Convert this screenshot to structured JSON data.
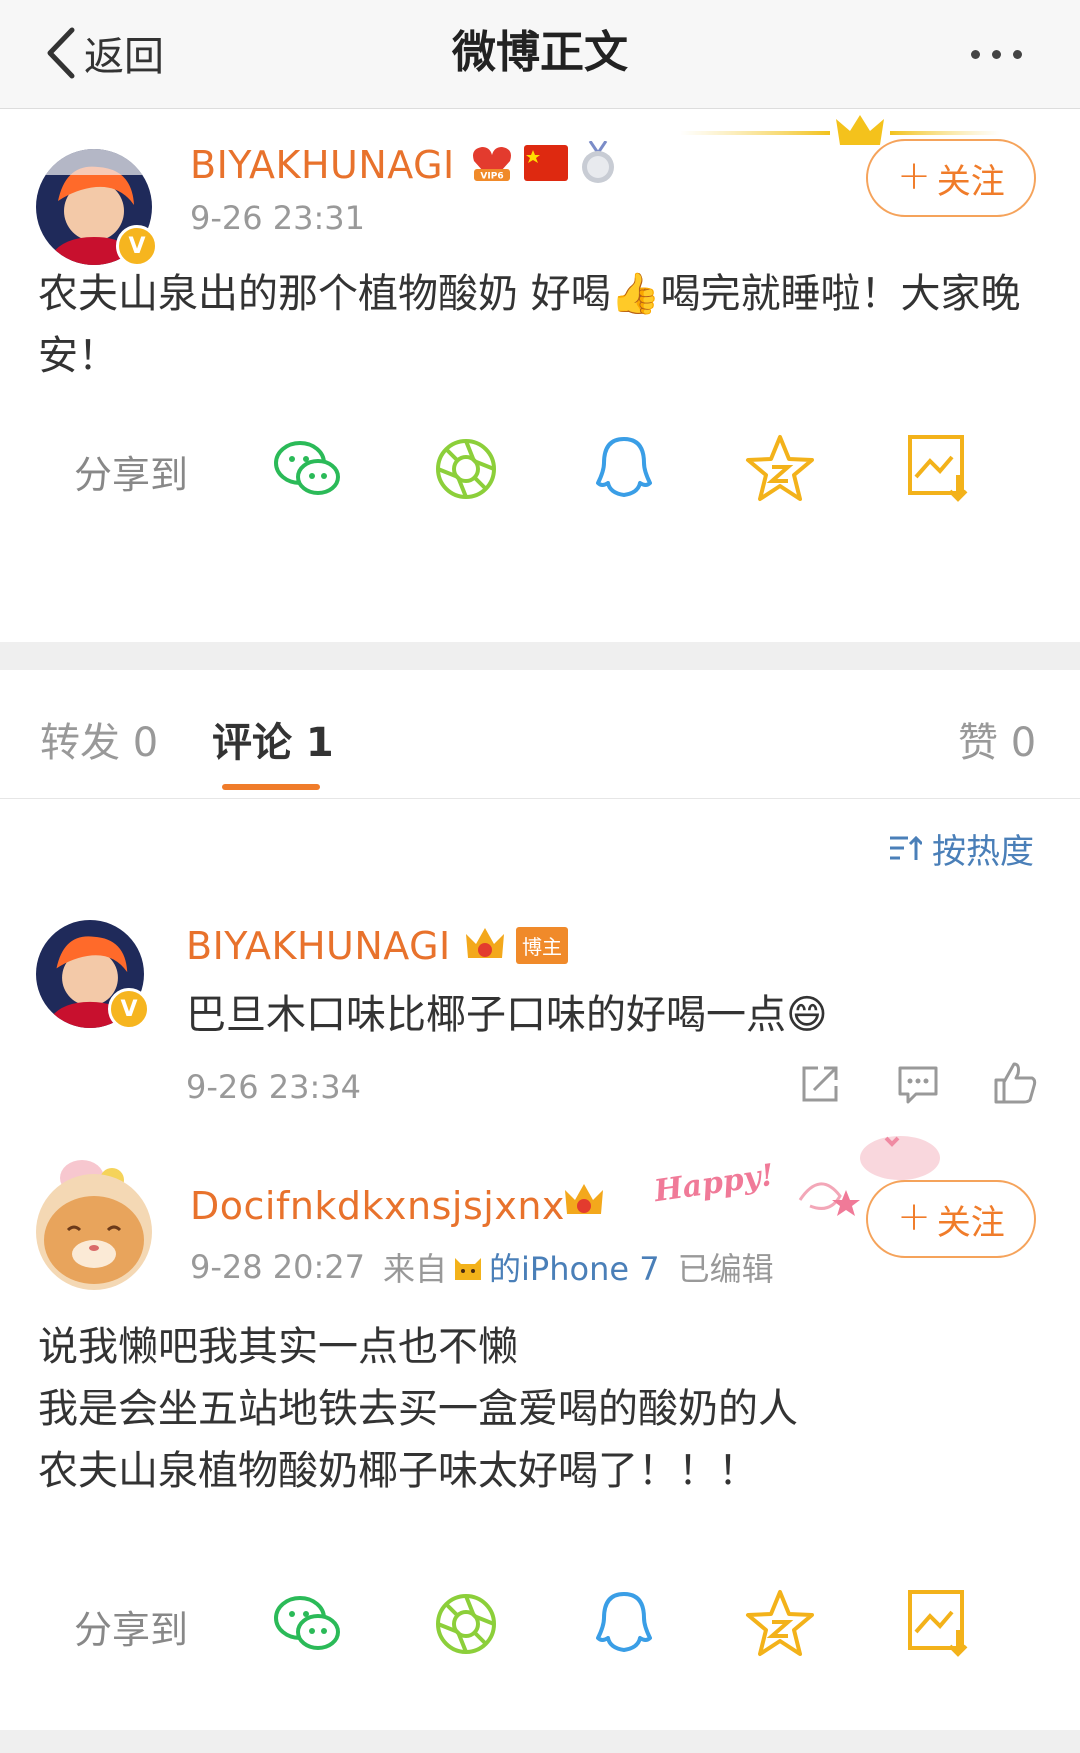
{
  "nav": {
    "back_label": "返回",
    "title": "微博正文"
  },
  "post": {
    "username": "BIYAKHUNAGI",
    "vip_label": "VIP6",
    "time": "9-26 23:31",
    "follow_label": "关注",
    "text": "农夫山泉出的那个植物酸奶 好喝👍喝完就睡啦！大家晚安！",
    "share_label": "分享到"
  },
  "tabs": {
    "repost": "转发 0",
    "comment": "评论 1",
    "like": "赞 0"
  },
  "sort_label": "按热度",
  "comments": [
    {
      "username": "BIYAKHUNAGI",
      "role_badge": "博主",
      "text": "巴旦木口味比椰子口味的好喝一点😄",
      "time": "9-26 23:34"
    }
  ],
  "post2": {
    "username": "Docifnkdkxnsjsjxnx",
    "time": "9-28 20:27",
    "source_prefix": "来自",
    "source_device": "的iPhone 7",
    "edited": "已编辑",
    "follow_label": "关注",
    "happy_sticker": "Happy!",
    "lines": [
      "说我懒吧我其实一点也不懒",
      "我是会坐五站地铁去买一盒爱喝的酸奶的人",
      "农夫山泉植物酸奶椰子味太好喝了！！！"
    ],
    "share_label": "分享到"
  },
  "colors": {
    "accent": "#f07c2a",
    "username": "#e8722c",
    "wechat": "#2bba58",
    "moments": "#8ccf3a",
    "qq": "#3a9ee6",
    "favorite": "#f3b21a",
    "save": "#f3b21a"
  }
}
